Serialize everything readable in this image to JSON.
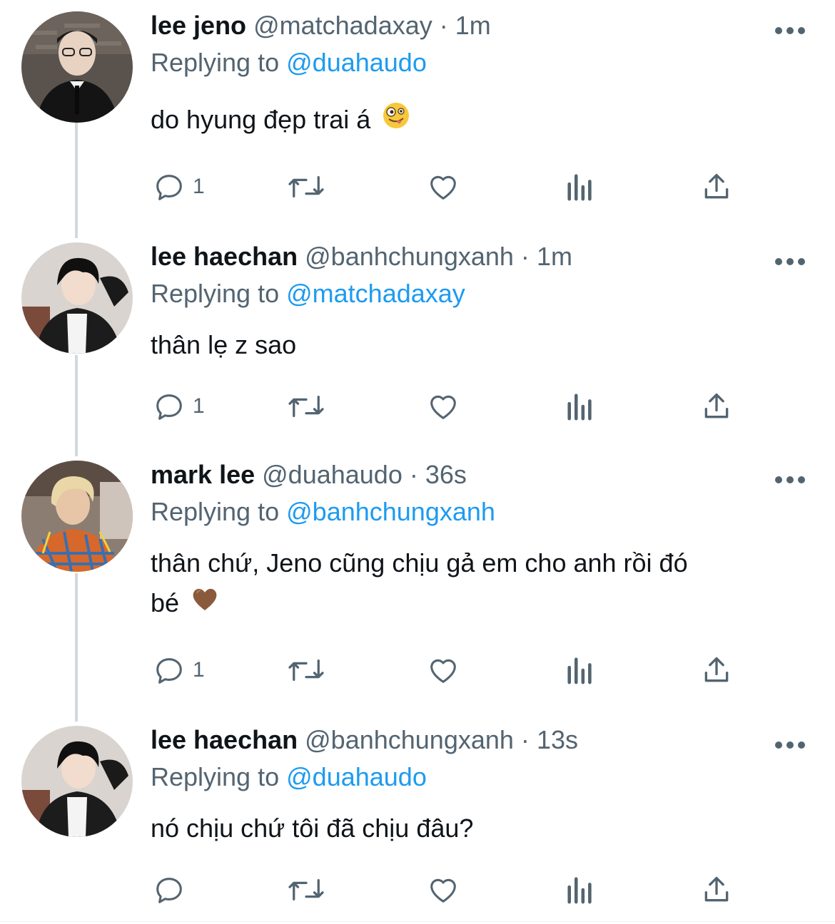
{
  "tweets": [
    {
      "name": "lee jeno",
      "handle": "@matchadaxay",
      "time": "1m",
      "reply_prefix": "Replying to",
      "reply_to": "@duahaudo",
      "text": "do hyung đẹp trai á",
      "emoji": "zany-face",
      "reply_count": "1",
      "avatar": "avatar-jeno"
    },
    {
      "name": "lee haechan",
      "handle": "@banhchungxanh",
      "time": "1m",
      "reply_prefix": "Replying to",
      "reply_to": "@matchadaxay",
      "text": "thân lẹ z sao",
      "reply_count": "1",
      "avatar": "avatar-haechan"
    },
    {
      "name": "mark lee",
      "handle": "@duahaudo",
      "time": "36s",
      "reply_prefix": "Replying to",
      "reply_to": "@banhchungxanh",
      "text_line1": "thân chứ, Jeno cũng chịu gả em cho anh rồi đó",
      "text_line2": "bé",
      "emoji": "brown-heart",
      "reply_count": "1",
      "avatar": "avatar-mark"
    },
    {
      "name": "lee haechan",
      "handle": "@banhchungxanh",
      "time": "13s",
      "reply_prefix": "Replying to",
      "reply_to": "@duahaudo",
      "text": "nó chịu chứ tôi đã chịu đâu?",
      "reply_count": "",
      "avatar": "avatar-haechan"
    }
  ],
  "separator": "·",
  "colors": {
    "link": "#1d9bf0",
    "muted": "#536471",
    "text": "#0f1419",
    "thread": "#cfd9de"
  },
  "icons": [
    "reply-icon",
    "retweet-icon",
    "like-icon",
    "views-icon",
    "share-icon",
    "more-icon"
  ]
}
